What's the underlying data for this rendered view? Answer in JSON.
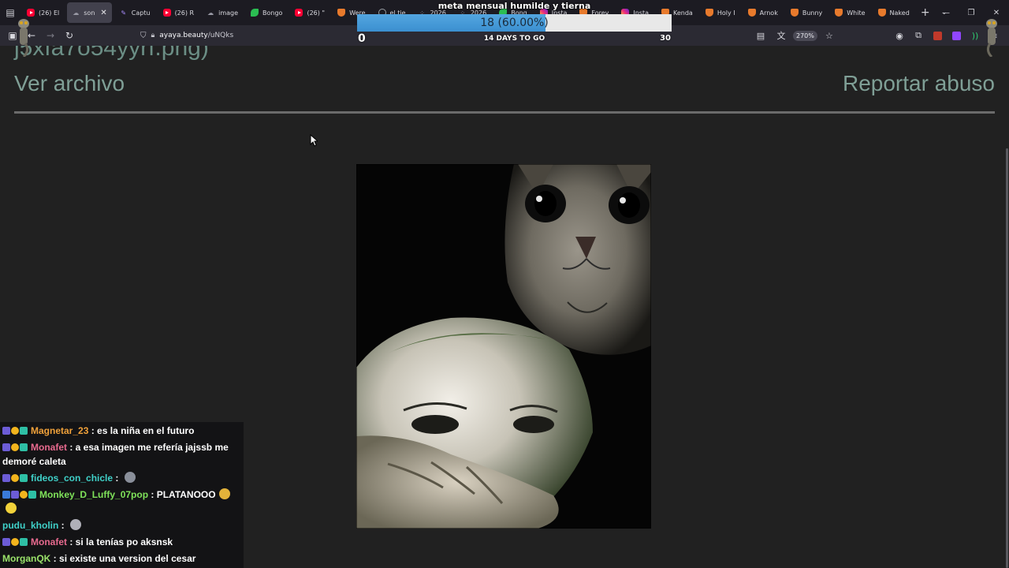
{
  "browser": {
    "tabs": [
      {
        "label": "(26) El",
        "icon": "youtube-icon",
        "active": false
      },
      {
        "label": "son",
        "icon": "cloud-icon",
        "active": true
      },
      {
        "label": "Captu",
        "icon": "pen-icon",
        "active": false
      },
      {
        "label": "(26) R",
        "icon": "youtube-icon",
        "active": false
      },
      {
        "label": "image",
        "icon": "cloud-icon",
        "active": false
      },
      {
        "label": "Bongo",
        "icon": "leaf-icon",
        "active": false
      },
      {
        "label": "(26) \"",
        "icon": "youtube-icon",
        "active": false
      },
      {
        "label": "Were",
        "icon": "fox-icon",
        "active": false
      },
      {
        "label": "el tie",
        "icon": "google-icon",
        "active": false
      },
      {
        "label": "2026",
        "icon": "dots-icon",
        "active": false
      },
      {
        "label": "2026",
        "icon": "dots-icon",
        "active": false
      },
      {
        "label": "Bong",
        "icon": "leaf-icon",
        "active": false
      },
      {
        "label": "Insta",
        "icon": "instagram-icon",
        "active": false
      },
      {
        "label": "Forev",
        "icon": "fox-icon",
        "active": false
      },
      {
        "label": "Insta",
        "icon": "instagram-icon",
        "active": false
      },
      {
        "label": "Kenda",
        "icon": "fox-icon",
        "active": false
      },
      {
        "label": "Holy I",
        "icon": "fox-icon",
        "active": false
      },
      {
        "label": "Arnok",
        "icon": "fox-icon",
        "active": false
      },
      {
        "label": "Bunny",
        "icon": "fox-icon",
        "active": false
      },
      {
        "label": "White",
        "icon": "fox-icon",
        "active": false
      },
      {
        "label": "Naked",
        "icon": "fox-icon",
        "active": false
      }
    ],
    "url_host": "ayaya.beauty",
    "url_path": "/uNQks",
    "zoom": "270%"
  },
  "goal": {
    "title": "meta mensual humilde y tierna",
    "current": 18,
    "percent": 60,
    "progress_text": "18 (60.00%)",
    "min": "0",
    "max": "30",
    "days_left": "14 DAYS TO GO"
  },
  "page": {
    "fragment": "j5xfa7o54yyrf.png)",
    "view_file": "Ver archivo",
    "report_abuse": "Reportar abuso"
  },
  "chat": [
    {
      "user": "Magnetar_23",
      "color": "#f0a13a",
      "badges": [
        "b-purple",
        "b-gold",
        "b-green"
      ],
      "text": "es la niña en el futuro",
      "emotes": []
    },
    {
      "user": "Monafet",
      "color": "#e86a8f",
      "badges": [
        "b-purple",
        "b-gold",
        "b-green"
      ],
      "text": "a esa imagen me refería jajssb me demoré caleta",
      "emotes": []
    },
    {
      "user": "fideos_con_chicle",
      "color": "#3fd0c8",
      "badges": [
        "b-purple",
        "b-gold",
        "b-green"
      ],
      "text": "",
      "emotes": [
        "#8a8f9a"
      ]
    },
    {
      "user": "Monkey_D_Luffy_07pop",
      "color": "#7fe35a",
      "badges": [
        "b-blue",
        "b-purple",
        "b-gold",
        "b-green"
      ],
      "text": "PLATANOOO",
      "emotes": [
        "#e2b23a",
        "#f2d23a"
      ]
    },
    {
      "user": "pudu_kholin",
      "color": "#3fd0c8",
      "badges": [],
      "text": "",
      "emotes": [
        "#b0b0b8"
      ]
    },
    {
      "user": "Monafet",
      "color": "#e86a8f",
      "badges": [
        "b-purple",
        "b-gold",
        "b-green"
      ],
      "text": "si la tenías po aksnsk",
      "emotes": []
    },
    {
      "user": "MorganQK",
      "color": "#9be36a",
      "badges": [],
      "text": "si existe una version del cesar",
      "emotes": []
    }
  ]
}
